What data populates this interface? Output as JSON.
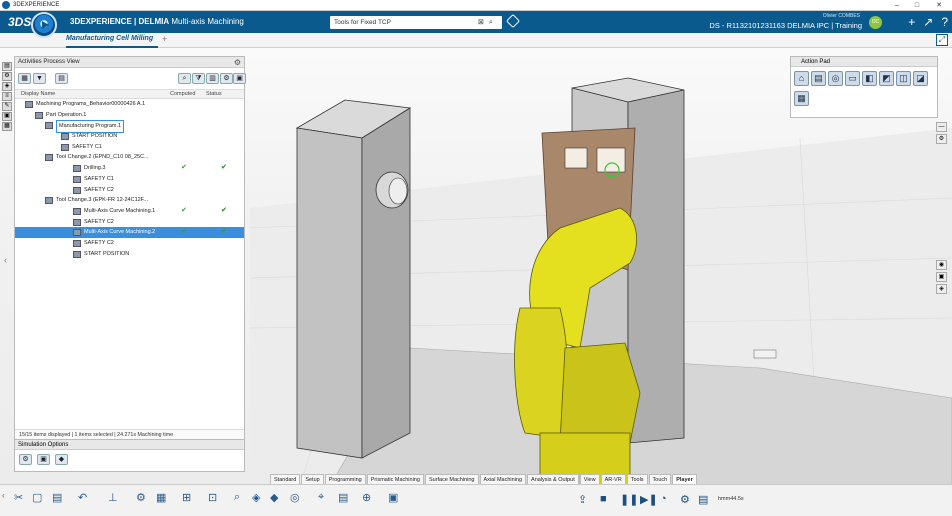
{
  "window": {
    "title": "3DEXPERIENCE",
    "minimize": "–",
    "maximize": "□",
    "close": "✕"
  },
  "topbar": {
    "brand_bold": "3DEXPERIENCE | DELMIA",
    "app_name": "Multi-axis Machining",
    "search_value": "Tools for Fixed TCP",
    "user_name": "Olivier COMBES",
    "context": "DS - R1132101231163 DELMIA IPC | Training",
    "avatar": "OC"
  },
  "tabs": {
    "active_label": "Manufacturing Cell Milling",
    "add": "+"
  },
  "panel": {
    "title": "Activities Process View",
    "columns": {
      "name": "Display Name",
      "computed": "Computed",
      "status": "Status"
    },
    "rows": [
      {
        "label": "Machining Programs_Behavior00000426 A.1",
        "level": 0,
        "computed": "",
        "status": ""
      },
      {
        "label": "Part Operation.1",
        "level": 1,
        "computed": "",
        "status": ""
      },
      {
        "label": "Manufacturing Program.1",
        "level": 2,
        "computed": "",
        "status": ""
      },
      {
        "label": "START POSITION",
        "level": 3,
        "computed": "",
        "status": ""
      },
      {
        "label": "SAFETY C1",
        "level": 3,
        "computed": "",
        "status": ""
      },
      {
        "label": "Tool Change.2 (EPND_C10 08_25C...",
        "level": 2,
        "computed": "",
        "status": ""
      },
      {
        "label": "Drilling.3",
        "level": 4,
        "computed": "✔",
        "status": "✔"
      },
      {
        "label": "SAFETY C1",
        "level": 4,
        "computed": "",
        "status": ""
      },
      {
        "label": "SAFETY C2",
        "level": 4,
        "computed": "",
        "status": ""
      },
      {
        "label": "Tool Change.3 (EPK-FR 12-24C12F...",
        "level": 2,
        "computed": "",
        "status": ""
      },
      {
        "label": "Multi-Axis Curve Machining.1",
        "level": 4,
        "computed": "✔",
        "status": "✔"
      },
      {
        "label": "SAFETY C2",
        "level": 4,
        "computed": "",
        "status": ""
      },
      {
        "label": "Multi-Axis Curve Machining.2",
        "level": 4,
        "computed": "✔",
        "status": "✔"
      },
      {
        "label": "SAFETY C2",
        "level": 4,
        "computed": "",
        "status": ""
      },
      {
        "label": "START POSITION",
        "level": 4,
        "computed": "",
        "status": ""
      }
    ],
    "status": "15/15 items displayed | 1 items selected | 24.271s Machining time"
  },
  "simulation": {
    "title": "Simulation Options"
  },
  "actionpad": {
    "title": "Action Pad"
  },
  "command_tabs": [
    "Standard",
    "Setup",
    "Programming",
    "Prismatic Machining",
    "Surface Machining",
    "Axial Machining",
    "Analysis & Output",
    "View",
    "AR-VR",
    "Tools",
    "Touch",
    "Player"
  ],
  "player": {
    "time": "hmm44.5s"
  }
}
